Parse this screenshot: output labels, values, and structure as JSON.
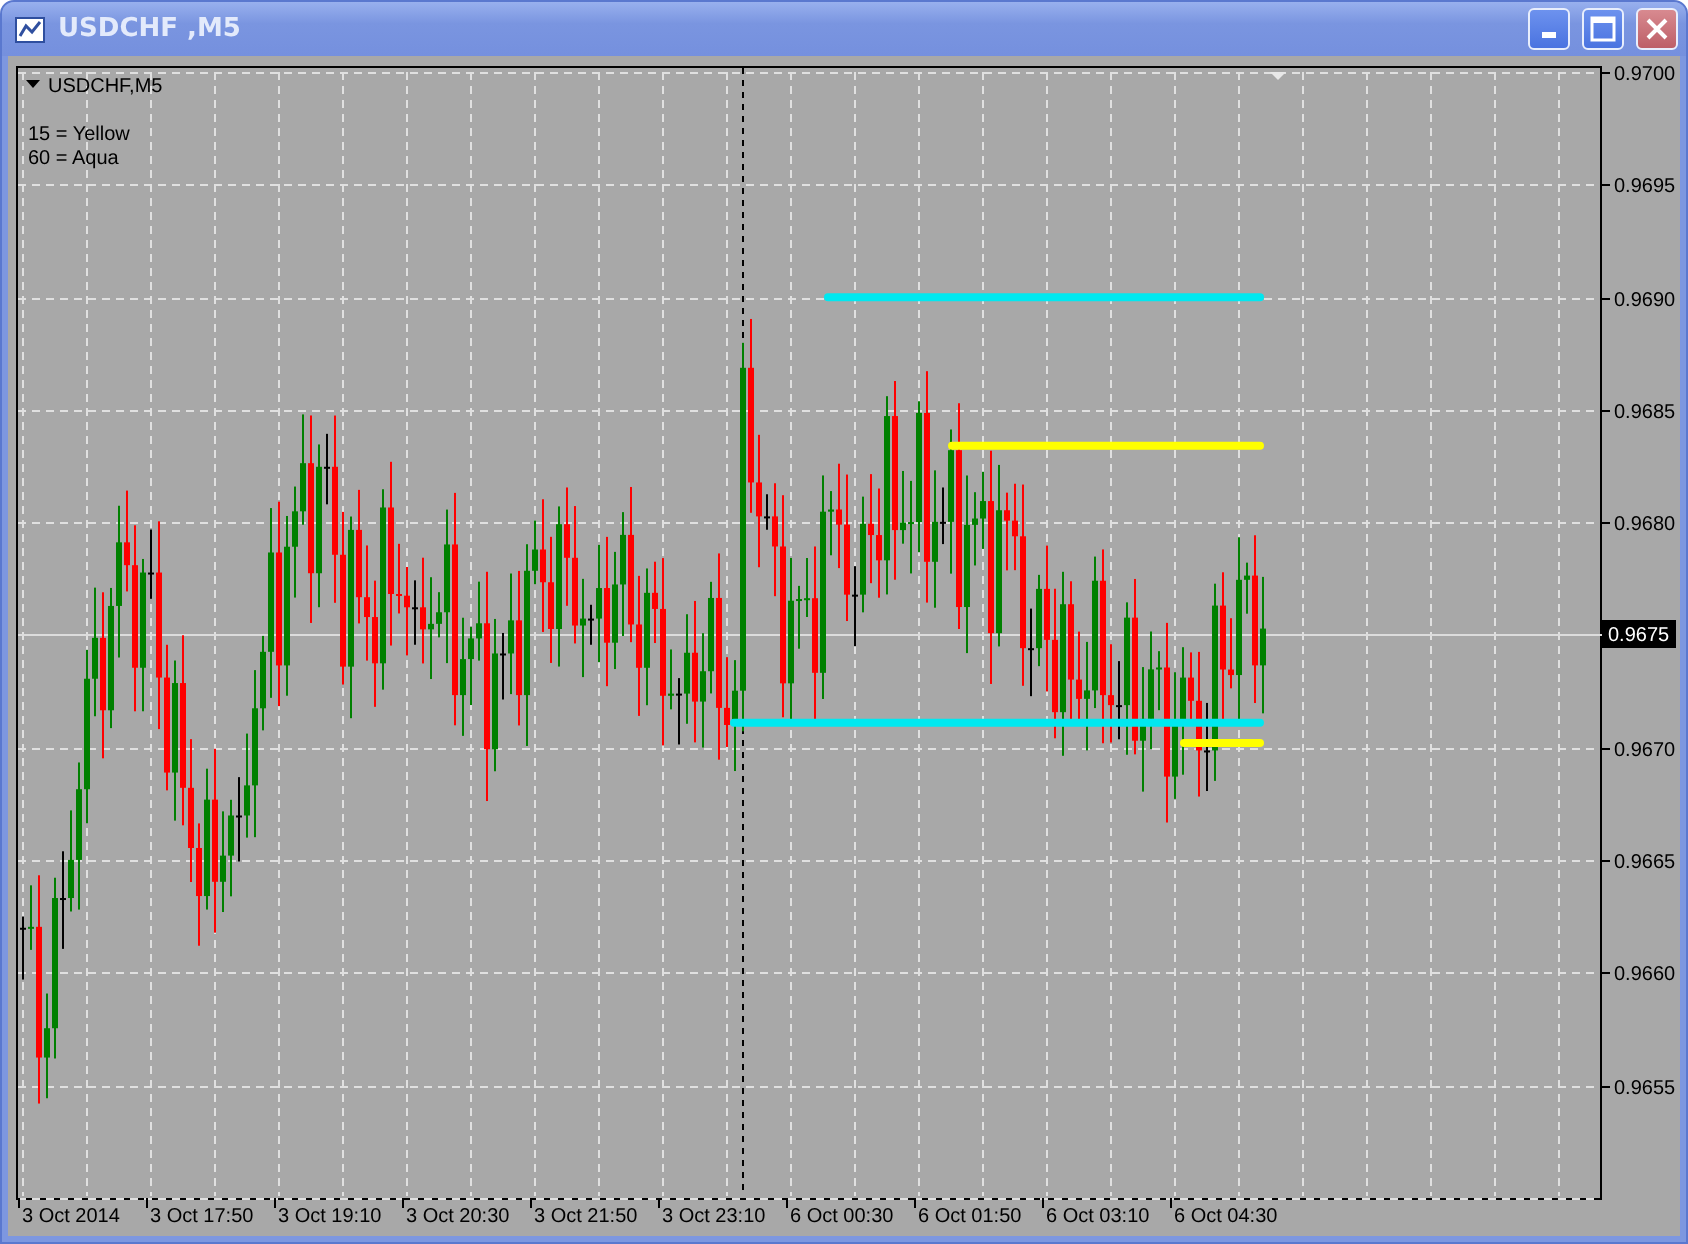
{
  "window": {
    "title": "USDCHF ,M5"
  },
  "chart": {
    "symbol_label": "USDCHF,M5",
    "legend": [
      "15 = Yellow",
      "60 = Aqua"
    ],
    "price_axis": [
      "0.9700",
      "0.9695",
      "0.9690",
      "0.9685",
      "0.9680",
      "0.9670",
      "0.9665",
      "0.9660",
      "0.9655"
    ],
    "current_price": "0.9675",
    "time_axis": [
      "3 Oct 2014",
      "3 Oct 17:50",
      "3 Oct 19:10",
      "3 Oct 20:30",
      "3 Oct 21:50",
      "3 Oct 23:10",
      "6 Oct 00:30",
      "6 Oct 01:50",
      "6 Oct 03:10",
      "6 Oct 04:30"
    ],
    "level_lines": [
      {
        "color": "#00e8f0"
      },
      {
        "color": "#ffff00"
      },
      {
        "color": "#00e8f0"
      },
      {
        "color": "#ffff00"
      }
    ]
  }
}
